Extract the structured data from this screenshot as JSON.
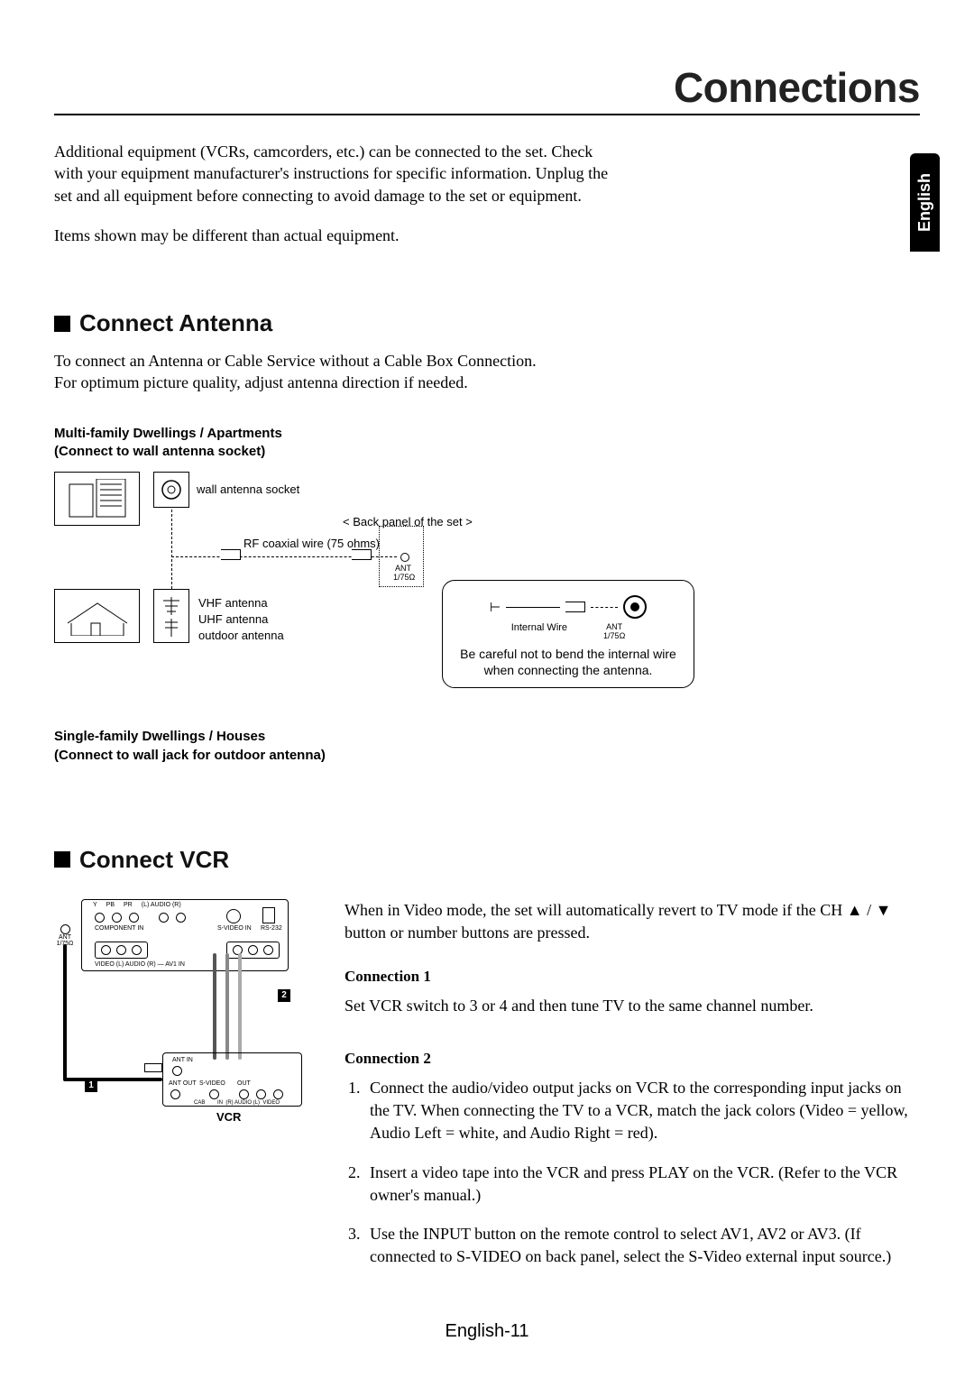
{
  "page_title": "Connections",
  "language_tab": "English",
  "intro": {
    "p1": "Additional equipment (VCRs, camcorders, etc.) can be connected to the set. Check with your equipment manufacturer's instructions for specific information. Unplug the set and all equipment before connecting to avoid damage to the set or equipment.",
    "p2": "Items shown may be different than actual equipment."
  },
  "antenna": {
    "heading": "Connect Antenna",
    "body1": "To connect an Antenna or Cable Service without a Cable Box Connection.",
    "body2": "For optimum picture quality, adjust antenna direction if needed.",
    "multi_title1": "Multi-family Dwellings / Apartments",
    "multi_title2": "(Connect to wall antenna socket)",
    "wall_socket": "wall antenna socket",
    "back_panel": "< Back panel of the set >",
    "rf_wire": "RF coaxial wire (75 ohms)",
    "ant_label": "ANT",
    "ant_ohm": "1/75Ω",
    "vhf": "VHF antenna",
    "uhf": "UHF antenna",
    "outdoor": "outdoor antenna",
    "single_title1": "Single-family Dwellings / Houses",
    "single_title2": "(Connect to wall jack for outdoor antenna)",
    "internal_wire": "Internal Wire",
    "callout_ant": "ANT",
    "callout_ohm": "1/75Ω",
    "callout_warn": "Be careful not to bend the internal wire when connecting the antenna."
  },
  "vcr": {
    "heading": "Connect VCR",
    "unit_label": "VCR",
    "badge1": "1",
    "badge2": "2",
    "panel_labels": {
      "y": "Y",
      "pb": "PB",
      "pr": "PR",
      "laudio": "(L) AUDIO (R)",
      "component": "COMPONENT IN",
      "svideoin": "S-VIDEO IN",
      "rs232": "RS-232",
      "av1": "AV1 IN",
      "video": "VIDEO",
      "audio": "(L) AUDIO (R)",
      "ant": "ANT",
      "ohm": "1/75Ω",
      "antin": "ANT IN",
      "antout": "ANT OUT",
      "svideo": "S-VIDEO",
      "out": "OUT",
      "cab": "CAB",
      "in": "IN",
      "raudio": "(R) AUDIO (L)",
      "vid": "VIDEO"
    },
    "intro": "When in Video mode, the set will automatically revert to TV mode if the CH ▲ / ▼ button or number buttons are pressed.",
    "c1_h": "Connection 1",
    "c1_body": "Set VCR switch to 3 or 4 and then tune TV to the same channel number.",
    "c2_h": "Connection 2",
    "c2_1": "Connect the audio/video output jacks on VCR to the corresponding input jacks on the TV. When connecting the TV to a VCR, match the jack colors (Video = yellow, Audio Left = white, and Audio Right = red).",
    "c2_2": "Insert a video tape into the VCR and press PLAY on the VCR. (Refer to the VCR owner's manual.)",
    "c2_3": "Use the INPUT button on the remote control to select AV1, AV2 or AV3. (If connected to S-VIDEO on back panel, select the S-Video external input source.)"
  },
  "page_number": "English-11"
}
